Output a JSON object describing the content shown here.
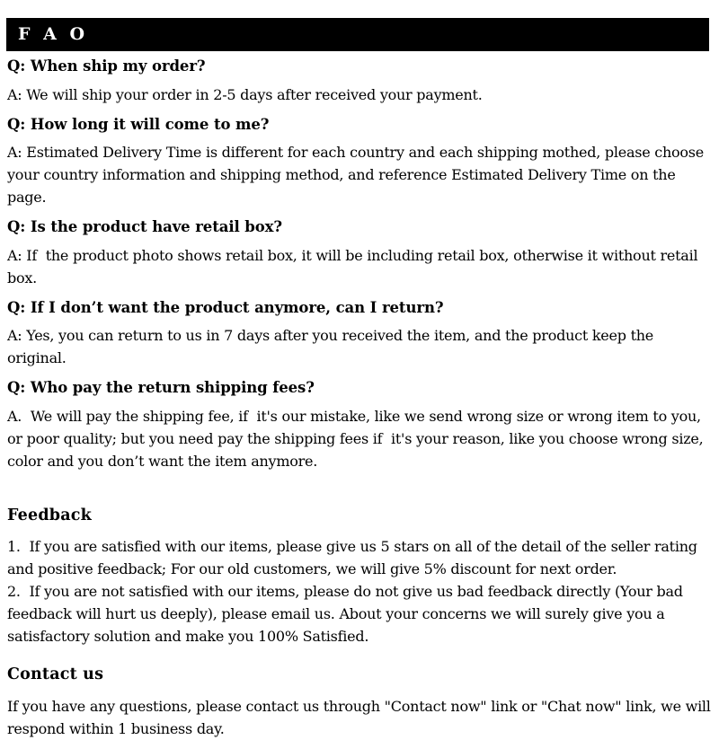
{
  "header": {
    "title": "F A O",
    "bar_color": "#000000",
    "text_color": "#ffffff"
  },
  "faq": {
    "items": [
      {
        "question": "Q: When ship my order?",
        "answer": "A: We will ship your order in 2-5 days after received your payment."
      },
      {
        "question": "Q: How long it will come to me?",
        "answer": "A: Estimated Delivery Time is different for each country and each shipping mothed, please choose your country information and shipping method, and reference Estimated Delivery Time on the page."
      },
      {
        "question": "Q: Is the product have retail box?",
        "answer": "A: If  the product photo shows retail box, it will be including retail box, otherwise it without retail box."
      },
      {
        "question": "Q: If I don’t want the product anymore, can I return?",
        "answer": "A: Yes, you can return to us in 7 days after you received the item, and the product keep the original."
      },
      {
        "question": "Q: Who pay the return shipping fees?",
        "answer": "A.  We will pay the shipping fee, if  it's our mistake, like we send wrong size or wrong item to you, or poor quality; but you need pay the shipping fees if  it's your reason, like you choose wrong size, color and you don’t want the item anymore."
      }
    ]
  },
  "feedback": {
    "title": "Feedback",
    "item1": "1.  If you are satisfied with our items, please give us 5 stars on all of the detail of the seller rating and positive feedback; For our old customers, we will give 5% discount for next order.",
    "item2": "2.  If you are not satisfied with our items, please do not give us bad feedback directly (Your bad feedback will hurt us deeply), please email us. About your concerns we will surely give you a satisfactory solution and make you 100% Satisfied."
  },
  "contact": {
    "title": "Contact us",
    "body": "If you have any questions, please contact us through \"Contact now\" link or \"Chat now\" link, we will respond within 1 business day."
  }
}
